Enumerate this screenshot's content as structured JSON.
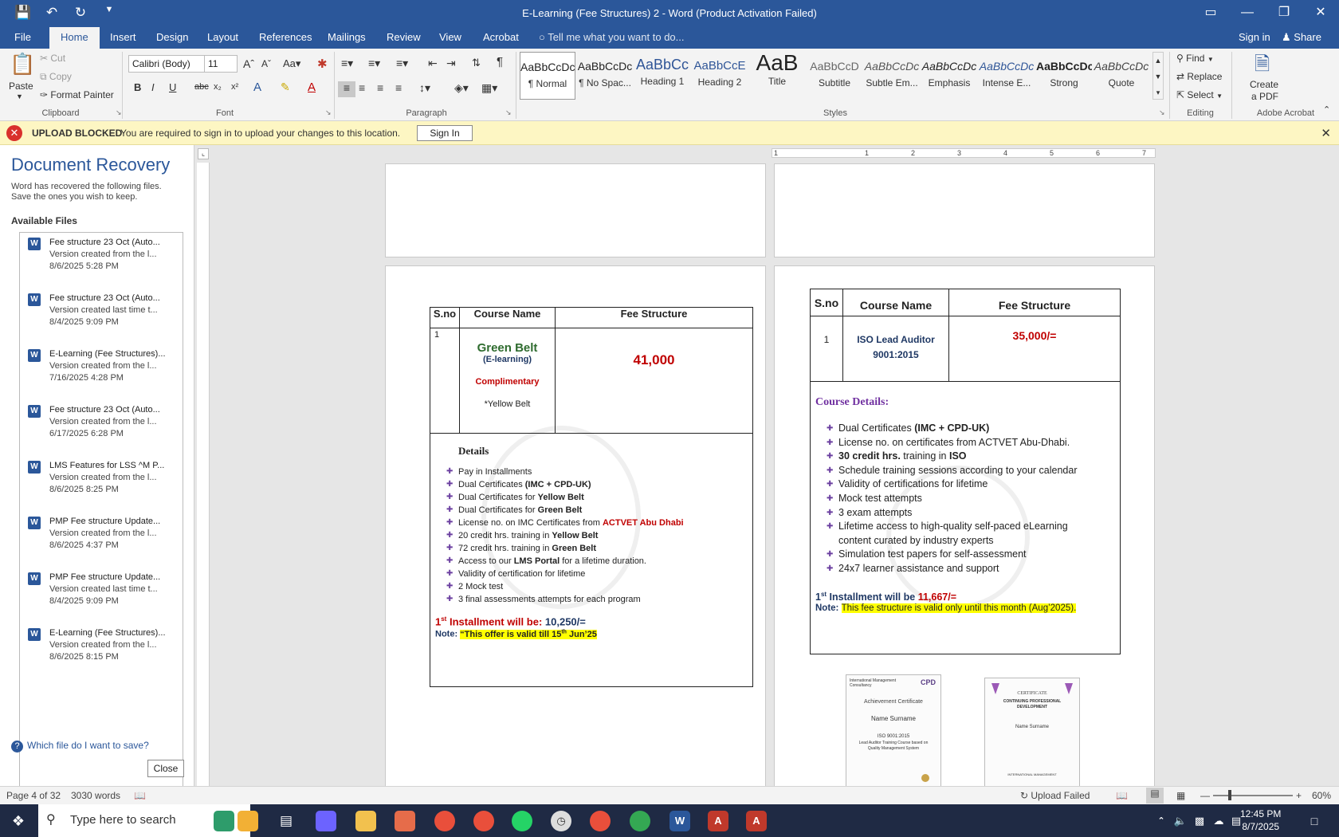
{
  "window": {
    "title": "E-Learning (Fee Structures) 2 - Word (Product Activation Failed)"
  },
  "tabs": [
    "File",
    "Home",
    "Insert",
    "Design",
    "Layout",
    "References",
    "Mailings",
    "Review",
    "View",
    "Acrobat"
  ],
  "tellme": "Tell me what you want to do...",
  "account": {
    "signin": "Sign in",
    "share": "Share"
  },
  "ribbon": {
    "clipboard": {
      "label": "Clipboard",
      "paste": "Paste",
      "cut": "Cut",
      "copy": "Copy",
      "format_painter": "Format Painter"
    },
    "font": {
      "label": "Font",
      "name": "Calibri (Body)",
      "size": "11"
    },
    "paragraph": {
      "label": "Paragraph"
    },
    "styles": {
      "label": "Styles",
      "items": [
        {
          "preview": "AaBbCcDc",
          "name": "¶ Normal"
        },
        {
          "preview": "AaBbCcDc",
          "name": "¶ No Spac..."
        },
        {
          "preview": "AaBbCc",
          "name": "Heading 1"
        },
        {
          "preview": "AaBbCcE",
          "name": "Heading 2"
        },
        {
          "preview": "AaB",
          "name": "Title"
        },
        {
          "preview": "AaBbCcD",
          "name": "Subtitle"
        },
        {
          "preview": "AaBbCcDc",
          "name": "Subtle Em..."
        },
        {
          "preview": "AaBbCcDc",
          "name": "Emphasis"
        },
        {
          "preview": "AaBbCcDc",
          "name": "Intense E..."
        },
        {
          "preview": "AaBbCcDc",
          "name": "Strong"
        },
        {
          "preview": "AaBbCcDc",
          "name": "Quote"
        }
      ]
    },
    "editing": {
      "label": "Editing",
      "find": "Find",
      "replace": "Replace",
      "select": "Select"
    },
    "acrobat": {
      "label": "Adobe Acrobat",
      "create": "Create",
      "create2": "a PDF"
    }
  },
  "message_bar": {
    "header": "UPLOAD BLOCKED",
    "text": "You are required to sign in to upload your changes to this location.",
    "button": "Sign In"
  },
  "recovery": {
    "title": "Document Recovery",
    "desc1": "Word has recovered the following files.",
    "desc2": "Save the ones you wish to keep.",
    "available": "Available Files",
    "files": [
      {
        "name": "Fee structure 23 Oct (Auto...",
        "note": "Version created from the l...",
        "date": "8/6/2025 5:28 PM"
      },
      {
        "name": "Fee structure 23 Oct (Auto...",
        "note": "Version created last time t...",
        "date": "8/4/2025 9:09 PM"
      },
      {
        "name": "E-Learning (Fee Structures)...",
        "note": "Version created from the l...",
        "date": "7/16/2025 4:28 PM"
      },
      {
        "name": "Fee structure 23 Oct (Auto...",
        "note": "Version created from the l...",
        "date": "6/17/2025 6:28 PM"
      },
      {
        "name": "LMS Features for LSS ^M P...",
        "note": "Version created from the l...",
        "date": "8/6/2025 8:25 PM"
      },
      {
        "name": "PMP Fee structure Update...",
        "note": "Version created from the l...",
        "date": "8/6/2025 4:37 PM"
      },
      {
        "name": "PMP Fee structure Update...",
        "note": "Version created last time t...",
        "date": "8/4/2025 9:09 PM"
      },
      {
        "name": "E-Learning (Fee Structures)...",
        "note": "Version created from the l...",
        "date": "8/6/2025 8:15 PM"
      }
    ],
    "help": "Which file do I want to save?",
    "close": "Close"
  },
  "left_table": {
    "headers": [
      "S.no",
      "Course Name",
      "Fee Structure"
    ],
    "sno": "1",
    "course": "Green Belt",
    "course_sub": "(E-learning)",
    "complimentary": "Complimentary",
    "yellow": "*Yellow Belt",
    "fee": "41,000",
    "details_title": "Details",
    "details": [
      {
        "pre": "Pay in Installments",
        "bold": "",
        "post": ""
      },
      {
        "pre": "Dual Certificates ",
        "bold": "(IMC + CPD-UK)",
        "post": ""
      },
      {
        "pre": "Dual Certificates for ",
        "bold": "Yellow Belt",
        "post": ""
      },
      {
        "pre": "Dual Certificates for ",
        "bold": "Green Belt",
        "post": ""
      },
      {
        "pre": "License no. on IMC Certificates from ",
        "red": "ACTVET Abu Dhabi",
        "bold": "",
        "post": ""
      },
      {
        "pre": "20 credit hrs. training in ",
        "bold": "Yellow Belt",
        "post": ""
      },
      {
        "pre": "72 credit hrs. training in ",
        "bold": "Green Belt",
        "post": ""
      },
      {
        "pre": "Access to our ",
        "bold": "LMS Portal",
        "post": " for a lifetime duration."
      },
      {
        "pre": "Validity of certification for lifetime",
        "bold": "",
        "post": ""
      },
      {
        "pre": "2 Mock test",
        "bold": "",
        "post": ""
      },
      {
        "pre": "3 final assessments attempts for each program",
        "bold": "",
        "post": ""
      }
    ],
    "installment_num": "1",
    "installment_sup": "st",
    "installment_label": " Installment will be: ",
    "installment_val": "10,250/=",
    "note_label": "Note: ",
    "note_text1": "“This offer is valid till 15",
    "note_sup": "th",
    "note_text2": " Jun’25"
  },
  "right_table": {
    "headers": [
      "S.no",
      "Course Name",
      "Fee Structure"
    ],
    "sno": "1",
    "course1": "ISO Lead Auditor",
    "course2": "9001:2015",
    "fee": "35,000/=",
    "details_title": "Course Details:",
    "details": [
      {
        "pre": "Dual Certificates ",
        "bold": "(IMC + CPD-UK)",
        "post": ""
      },
      {
        "pre": "License no. on certificates from ACTVET Abu-Dhabi.",
        "bold": "",
        "post": ""
      },
      {
        "pre": "",
        "bold": "30 credit hrs.",
        "post": " training in ",
        "bold2": "ISO"
      },
      {
        "pre": "Schedule training sessions according to your calendar",
        "bold": "",
        "post": ""
      },
      {
        "pre": "Validity of certifications for lifetime",
        "bold": "",
        "post": ""
      },
      {
        "pre": "Mock test attempts",
        "bold": "",
        "post": ""
      },
      {
        "pre": "3 exam attempts",
        "bold": "",
        "post": ""
      },
      {
        "pre": "Lifetime access to high-quality self-paced eLearning",
        "bold": "",
        "post": ""
      },
      {
        "pre": "content curated by industry experts",
        "bold": "",
        "post": "",
        "cont": true
      },
      {
        "pre": "Simulation test papers for self-assessment",
        "bold": "",
        "post": ""
      },
      {
        "pre": "24x7 learner assistance and support",
        "bold": "",
        "post": ""
      }
    ],
    "installment_num": "1",
    "installment_sup": "st",
    "installment_label": " Installment will be ",
    "installment_val": "11,667/=",
    "note_label": "Note: ",
    "note_text": "This fee structure is valid only until this month (Aug’2025)."
  },
  "certs": {
    "c1": {
      "org": "International Management Consultancy",
      "title": "Achievement Certificate",
      "name": "Name Surname",
      "course": "ISO 9001:2015",
      "course2": "Lead Auditor Training Course based on",
      "course3": "Quality Management System",
      "cpd": "CPD"
    },
    "c2": {
      "title": "CERTIFICATE",
      "sub": "CONTINUING PROFESSIONAL",
      "sub2": "DEVELOPMENT",
      "name": "Name Surname",
      "org": "INTERNATIONAL MANAGEMENT"
    }
  },
  "ruler": {
    "marks": [
      "1",
      "1",
      "2",
      "3",
      "4",
      "5",
      "6",
      "7"
    ]
  },
  "status": {
    "page": "Page 4 of 32",
    "words": "3030 words",
    "upload": "Upload Failed",
    "zoom": "60%"
  },
  "taskbar": {
    "search": "Type here to search",
    "time": "12:45 PM",
    "date": "8/7/2025"
  }
}
